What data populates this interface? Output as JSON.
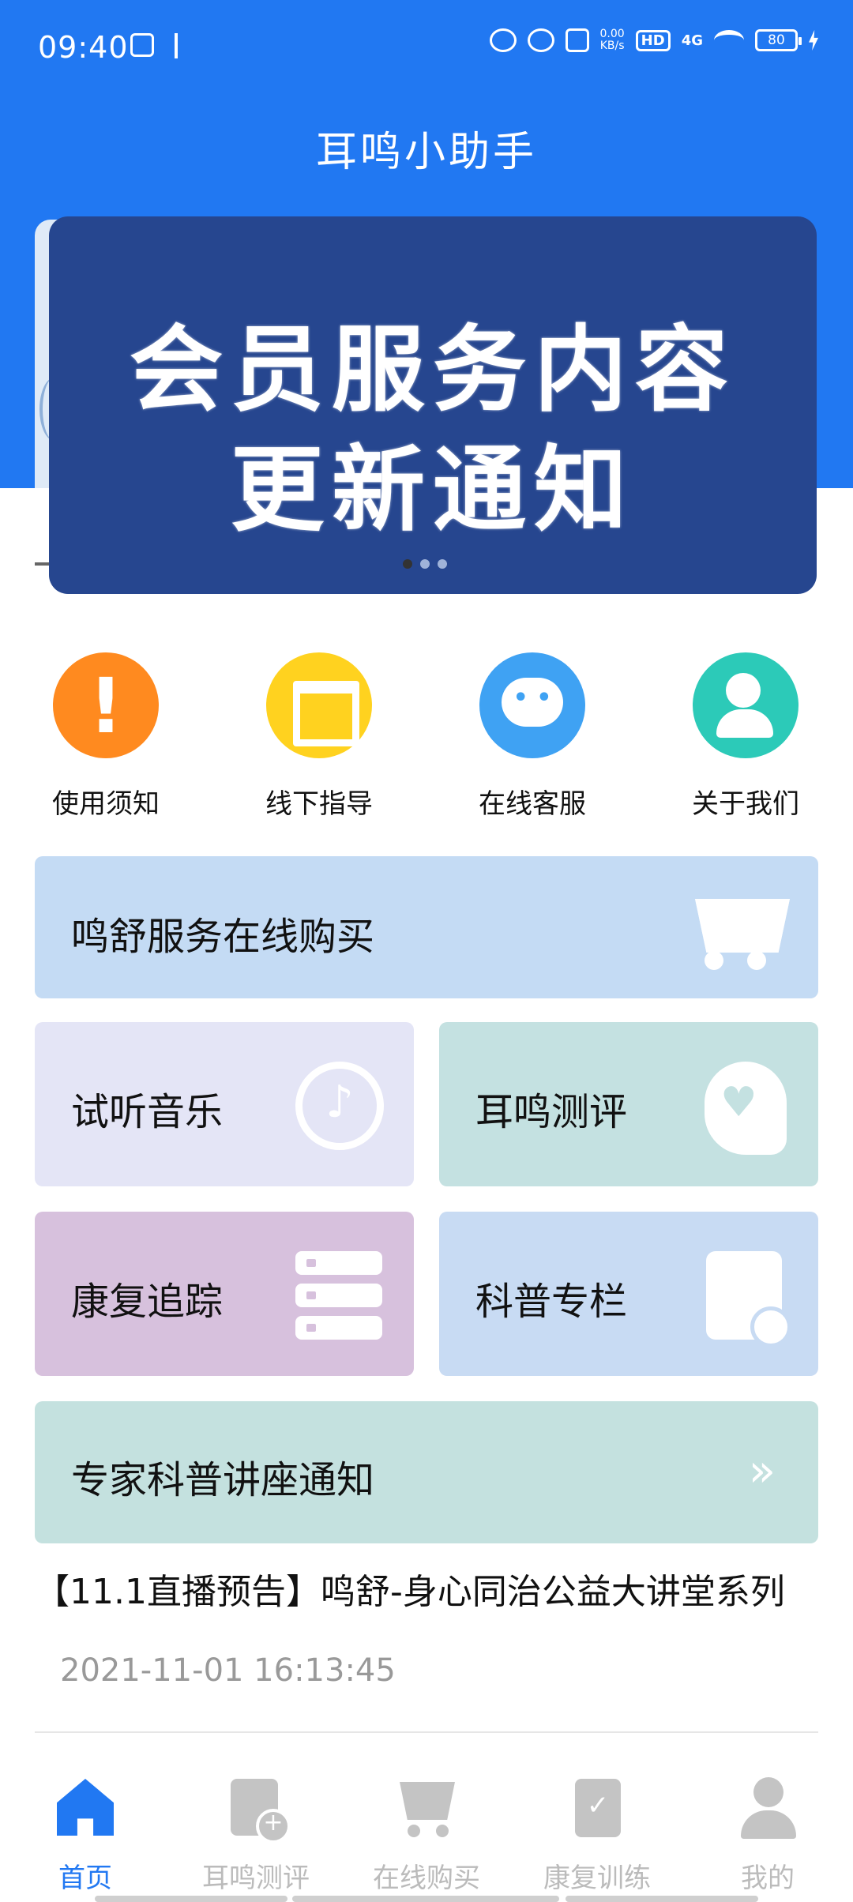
{
  "status_bar": {
    "time": "09:40",
    "net_speed": "0.00",
    "net_unit": "KB/s",
    "hd": "HD",
    "network": "4G",
    "battery": "80"
  },
  "header": {
    "title": "耳鸣小助手"
  },
  "banner": {
    "line1": "会员服务内容",
    "line2": "更新通知",
    "pages": 3,
    "active_page": 1
  },
  "quick_actions": [
    {
      "label": "使用须知",
      "icon": "exclamation-icon",
      "color": "#ff8a1f"
    },
    {
      "label": "线下指导",
      "icon": "store-icon",
      "color": "#ffd21f"
    },
    {
      "label": "在线客服",
      "icon": "chat-bubble-icon",
      "color": "#3fa2f3"
    },
    {
      "label": "关于我们",
      "icon": "users-icon",
      "color": "#2ccab8"
    }
  ],
  "cards": {
    "buy": {
      "label": "鸣舒服务在线购买",
      "icon": "shopping-cart-icon"
    },
    "music": {
      "label": "试听音乐",
      "icon": "music-disc-icon"
    },
    "evaluation": {
      "label": "耳鸣测评",
      "icon": "head-heart-icon"
    },
    "tracking": {
      "label": "康复追踪",
      "icon": "server-list-icon"
    },
    "science": {
      "label": "科普专栏",
      "icon": "calendar-clock-icon"
    },
    "lecture": {
      "label": "专家科普讲座通知",
      "icon": "double-chevron-right-icon"
    }
  },
  "article": {
    "title": "【11.1直播预告】鸣舒-身心同治公益大讲堂系列",
    "time": "2021-11-01 16:13:45"
  },
  "bottom_nav": [
    {
      "label": "首页",
      "icon": "home-icon",
      "active": true
    },
    {
      "label": "耳鸣测评",
      "icon": "document-add-icon",
      "active": false
    },
    {
      "label": "在线购买",
      "icon": "shopping-cart-icon",
      "active": false
    },
    {
      "label": "康复训练",
      "icon": "clipboard-check-icon",
      "active": false
    },
    {
      "label": "我的",
      "icon": "user-icon",
      "active": false
    }
  ],
  "colors": {
    "primary": "#2178f2",
    "banner": "#26468f"
  }
}
